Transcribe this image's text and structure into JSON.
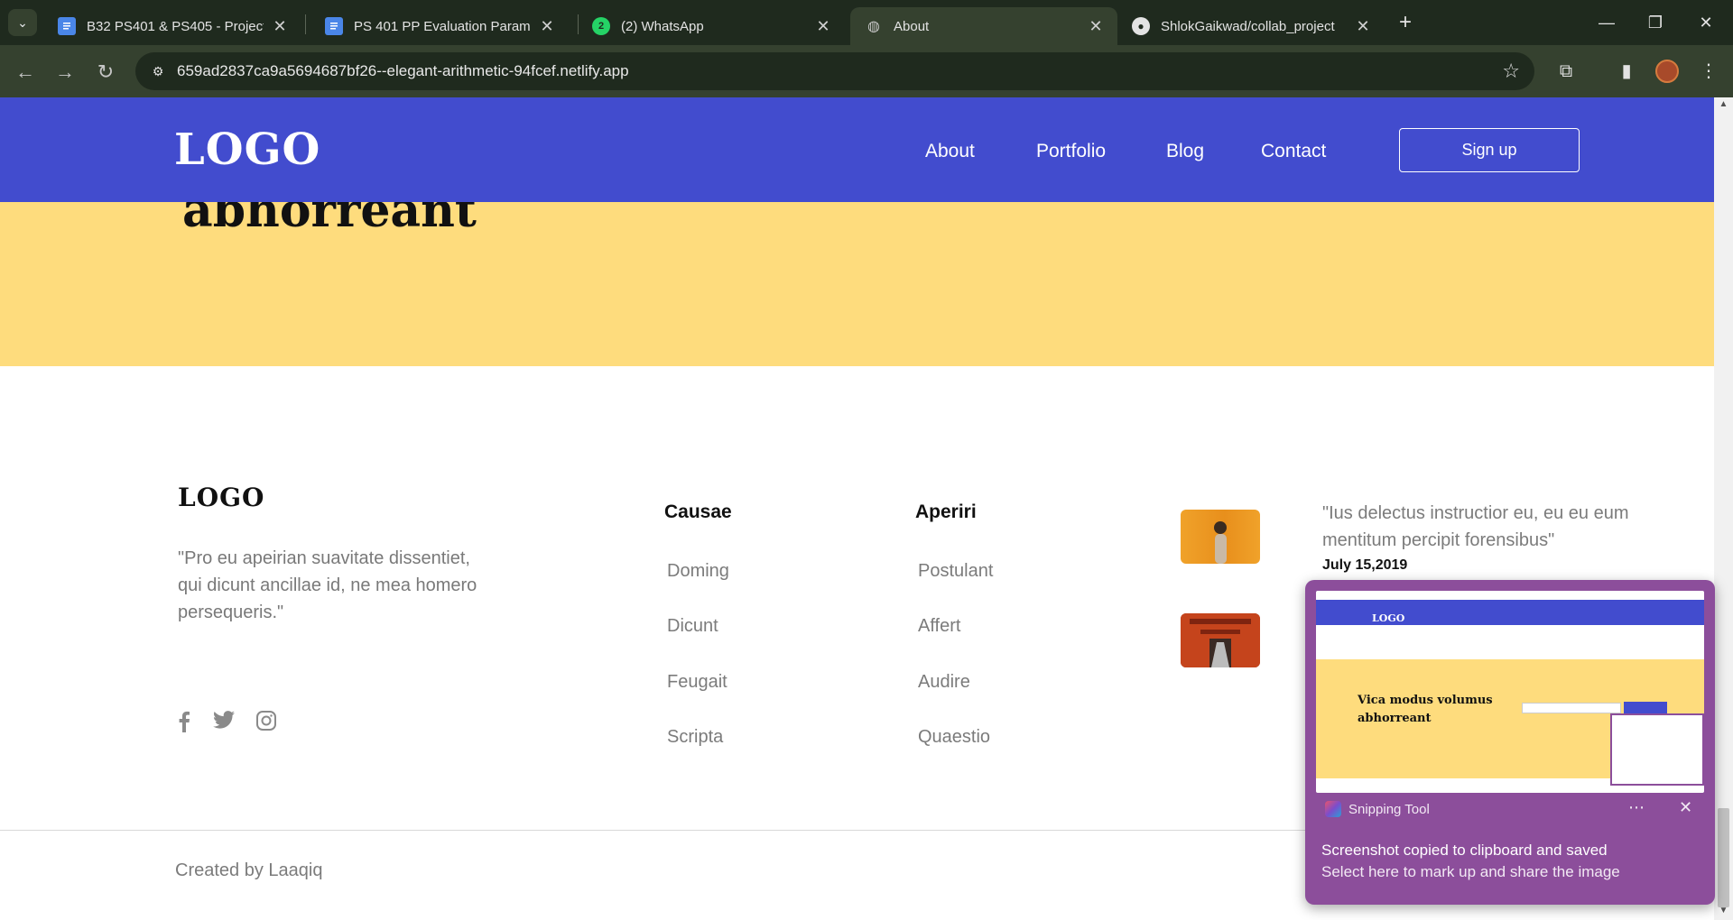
{
  "browser": {
    "tabs": [
      {
        "title": "B32 PS401 & PS405 - Project Pr",
        "icon": "google-docs-icon",
        "active": false
      },
      {
        "title": "PS 401 PP Evaluation Parameter",
        "icon": "google-docs-icon",
        "active": false
      },
      {
        "title": "(2) WhatsApp",
        "icon": "whatsapp-icon",
        "active": false
      },
      {
        "title": "About",
        "icon": "globe-icon",
        "active": true
      },
      {
        "title": "ShlokGaikwad/collab_project",
        "icon": "github-icon",
        "active": false
      }
    ],
    "url": "659ad2837ca9a5694687bf26--elegant-arithmetic-94fcef.netlify.app"
  },
  "site": {
    "header": {
      "logo": "LOGO",
      "nav": [
        "About",
        "Portfolio",
        "Blog",
        "Contact"
      ],
      "signup_label": "Sign up",
      "color": "#424cce"
    },
    "hero": {
      "title_fragment": "abhorreant",
      "color": "#fedc7d"
    },
    "footer": {
      "logo": "LOGO",
      "quote": "\"Pro eu apeirian suavitate dissentiet, qui dicunt ancillae id, ne mea homero persequeris.\"",
      "social": [
        "facebook-icon",
        "twitter-icon",
        "instagram-icon"
      ],
      "columns": [
        {
          "title": "Causae",
          "links": [
            "Doming",
            "Dicunt",
            "Feugait",
            "Scripta"
          ]
        },
        {
          "title": "Aperiri",
          "links": [
            "Postulant",
            "Affert",
            "Audire",
            "Quaestio"
          ]
        }
      ],
      "post": {
        "quote": "\"Ius delectus instructior eu, eu eu eum mentitum percipit forensibus\"",
        "date": "July 15,2019"
      },
      "credit": "Created by Laaqiq"
    }
  },
  "snipping_tool": {
    "app_name": "Snipping Tool",
    "message": "Screenshot copied to clipboard and saved",
    "sub_message": "Select here to mark up and share the image",
    "preview": {
      "logo": "LOGO",
      "title": "Vica modus volumus abhorreant"
    }
  }
}
